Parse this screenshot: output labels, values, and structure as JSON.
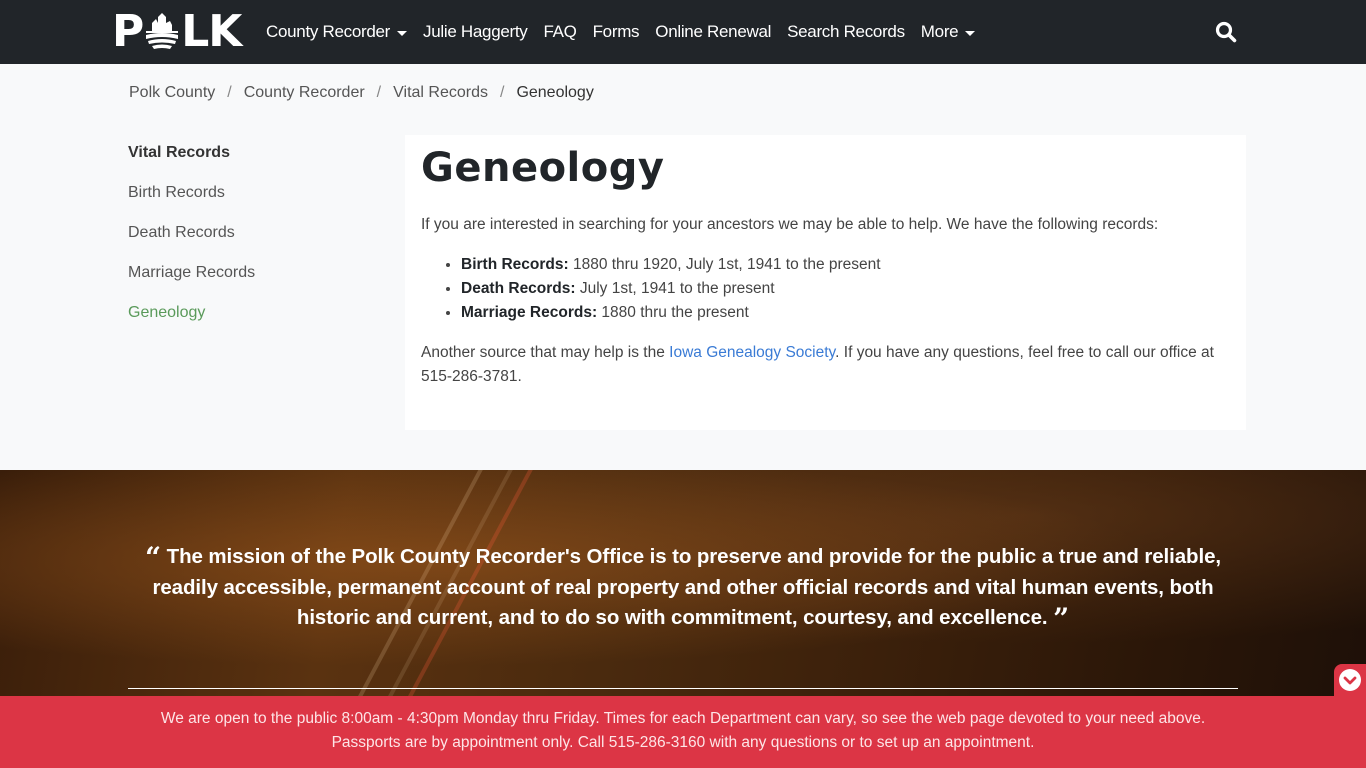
{
  "navbar": {
    "brand": {
      "left": "P",
      "right": "LK",
      "logo_alt": "POLK"
    },
    "items": [
      {
        "label": "County Recorder",
        "dropdown": true
      },
      {
        "label": "Julie Haggerty",
        "dropdown": false
      },
      {
        "label": "FAQ",
        "dropdown": false
      },
      {
        "label": "Forms",
        "dropdown": false
      },
      {
        "label": "Online Renewal",
        "dropdown": false
      },
      {
        "label": "Search Records",
        "dropdown": false
      },
      {
        "label": "More",
        "dropdown": true
      }
    ],
    "search_icon": "search-icon"
  },
  "breadcrumb": {
    "items": [
      "Polk County",
      "County Recorder",
      "Vital Records"
    ],
    "separator": "/",
    "current": "Geneology"
  },
  "sidebar": {
    "heading": "Vital Records",
    "items": [
      {
        "label": "Birth Records",
        "active": false
      },
      {
        "label": "Death Records",
        "active": false
      },
      {
        "label": "Marriage Records",
        "active": false
      },
      {
        "label": "Geneology",
        "active": true
      }
    ],
    "active_color": "#5a9a5a"
  },
  "main": {
    "title": "Geneology",
    "intro": "If you are interested in searching for your ancestors we may be able to help. We have the following records:",
    "records": [
      {
        "label": "Birth Records:",
        "text": " 1880 thru 1920, July 1st, 1941 to the present"
      },
      {
        "label": "Death Records:",
        "text": " July 1st, 1941 to the present"
      },
      {
        "label": "Marriage Records:",
        "text": " 1880 thru the present"
      }
    ],
    "outro_before": "Another source that may help is the ",
    "outro_link": "Iowa Genealogy Society",
    "outro_after": ". If you have any questions, feel free to call our office at 515-286-3781.",
    "link_color": "#3a7bd5"
  },
  "mission": {
    "open_quote": "“",
    "text": "The mission of the Polk County Recorder's Office is to preserve and provide for the public a true and reliable, readily accessible, permanent account of real property and other official records and vital human events, both historic and current, and to do so with commitment, courtesy, and excellence.",
    "close_quote": "”"
  },
  "alert": {
    "text": "We are open to the public 8:00am - 4:30pm Monday thru Friday. Times for each Department can vary, so see the web page devoted to your need above. Passports are by appointment only. Call 515-286-3160 with any questions or to set up an appointment.",
    "bg_color": "#dc3545"
  },
  "colors": {
    "navbar_bg": "#212529",
    "page_bg": "#f8f9fa"
  }
}
